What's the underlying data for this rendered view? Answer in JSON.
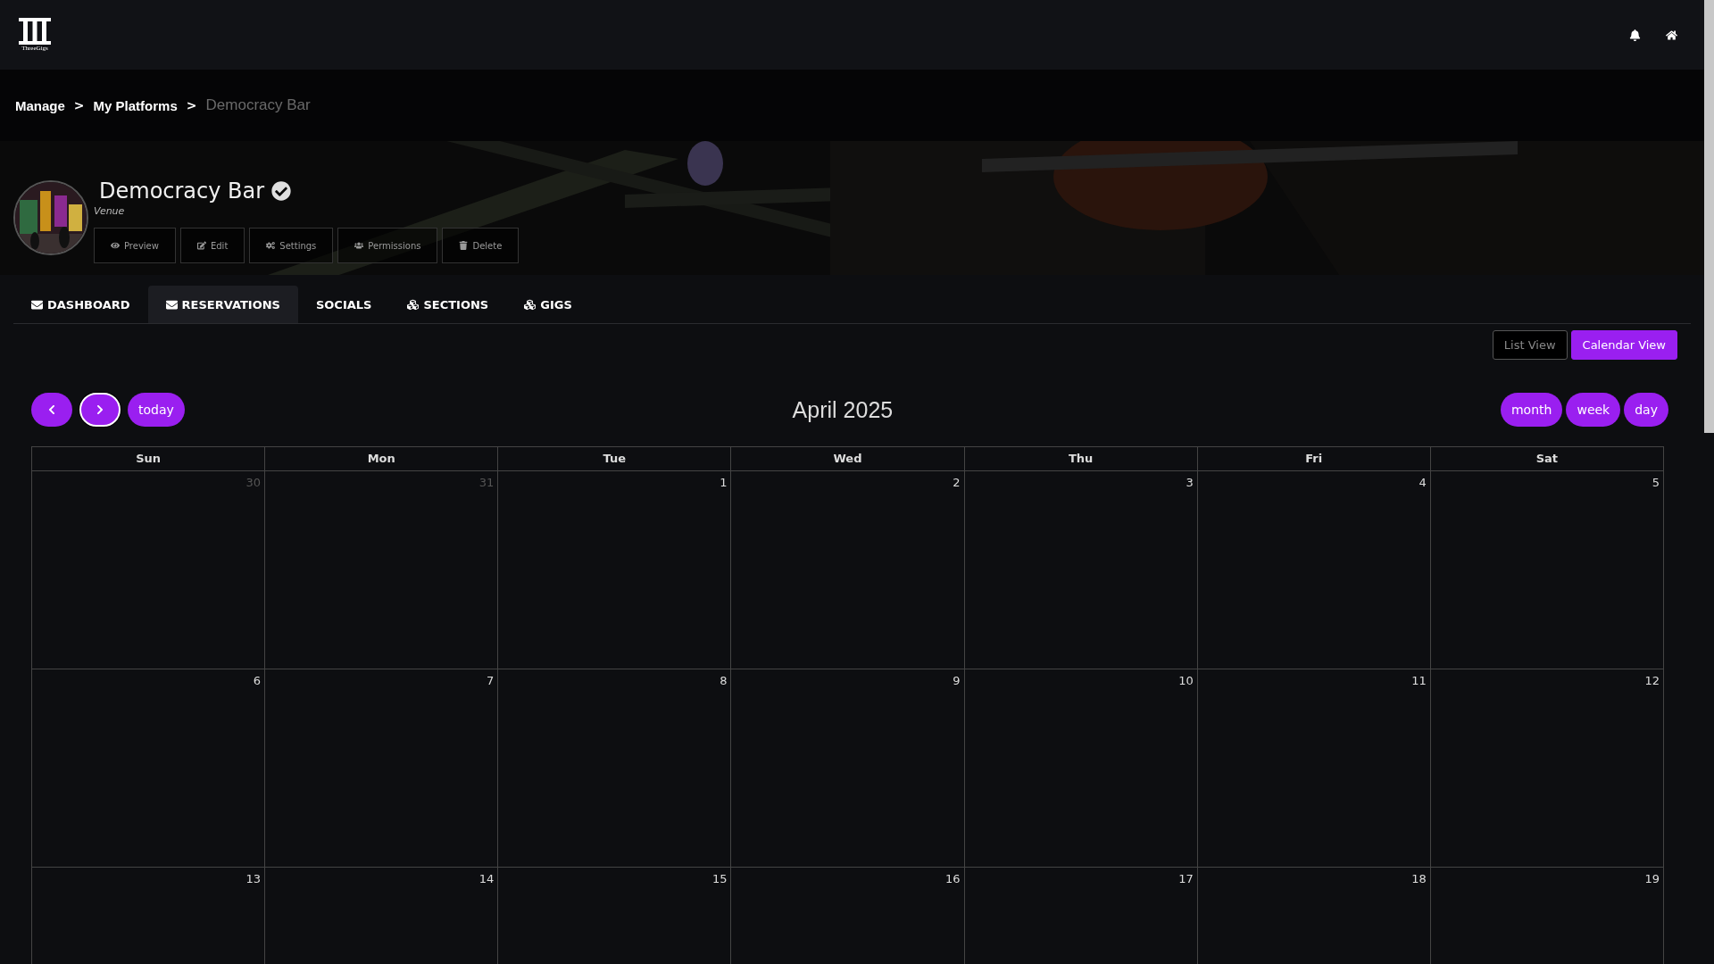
{
  "header": {
    "logo_text": "ThreeGigs"
  },
  "breadcrumb": [
    {
      "label": "Manage",
      "current": false
    },
    {
      "label": "My Platforms",
      "current": false
    },
    {
      "label": "Democracy Bar",
      "current": true
    }
  ],
  "breadcrumb_separator": ">",
  "profile": {
    "name": "Democracy Bar",
    "verified": true,
    "type": "Venue",
    "actions": [
      {
        "label": "Preview",
        "kind": "eye"
      },
      {
        "label": "Edit",
        "kind": "edit"
      },
      {
        "label": "Settings",
        "kind": "cogs"
      },
      {
        "label": "Permissions",
        "kind": "users"
      },
      {
        "label": "Delete",
        "kind": "trash"
      }
    ]
  },
  "tabs": [
    {
      "label": "DASHBOARD",
      "kind": "envelope",
      "selected": false
    },
    {
      "label": "RESERVATIONS",
      "kind": "envelope",
      "selected": true
    },
    {
      "label": "SOCIALS",
      "kind": "plain",
      "selected": false
    },
    {
      "label": "SECTIONS",
      "kind": "cubes",
      "selected": false
    },
    {
      "label": "GIGS",
      "kind": "cubes",
      "selected": false
    }
  ],
  "view_toggle": [
    {
      "label": "List View",
      "selected": false
    },
    {
      "label": "Calendar View",
      "selected": true
    }
  ],
  "calendar": {
    "title": "April 2025",
    "nav": [
      {
        "kind": "prev",
        "focused": false
      },
      {
        "kind": "next",
        "focused": true
      }
    ],
    "today_label": "today",
    "views": [
      {
        "label": "month"
      },
      {
        "label": "week"
      },
      {
        "label": "day"
      }
    ],
    "weekdays": [
      "Sun",
      "Mon",
      "Tue",
      "Wed",
      "Thu",
      "Fri",
      "Sat"
    ],
    "weeks": [
      [
        {
          "day": "30",
          "other_month": true
        },
        {
          "day": "31",
          "other_month": true
        },
        {
          "day": "1",
          "other_month": false
        },
        {
          "day": "2",
          "other_month": false
        },
        {
          "day": "3",
          "other_month": false
        },
        {
          "day": "4",
          "other_month": false
        },
        {
          "day": "5",
          "other_month": false
        }
      ],
      [
        {
          "day": "6",
          "other_month": false
        },
        {
          "day": "7",
          "other_month": false
        },
        {
          "day": "8",
          "other_month": false
        },
        {
          "day": "9",
          "other_month": false
        },
        {
          "day": "10",
          "other_month": false
        },
        {
          "day": "11",
          "other_month": false
        },
        {
          "day": "12",
          "other_month": false
        }
      ],
      [
        {
          "day": "13",
          "other_month": false
        },
        {
          "day": "14",
          "other_month": false
        },
        {
          "day": "15",
          "other_month": false
        },
        {
          "day": "16",
          "other_month": false
        },
        {
          "day": "17",
          "other_month": false
        },
        {
          "day": "18",
          "other_month": false
        },
        {
          "day": "19",
          "other_month": false
        }
      ]
    ]
  }
}
